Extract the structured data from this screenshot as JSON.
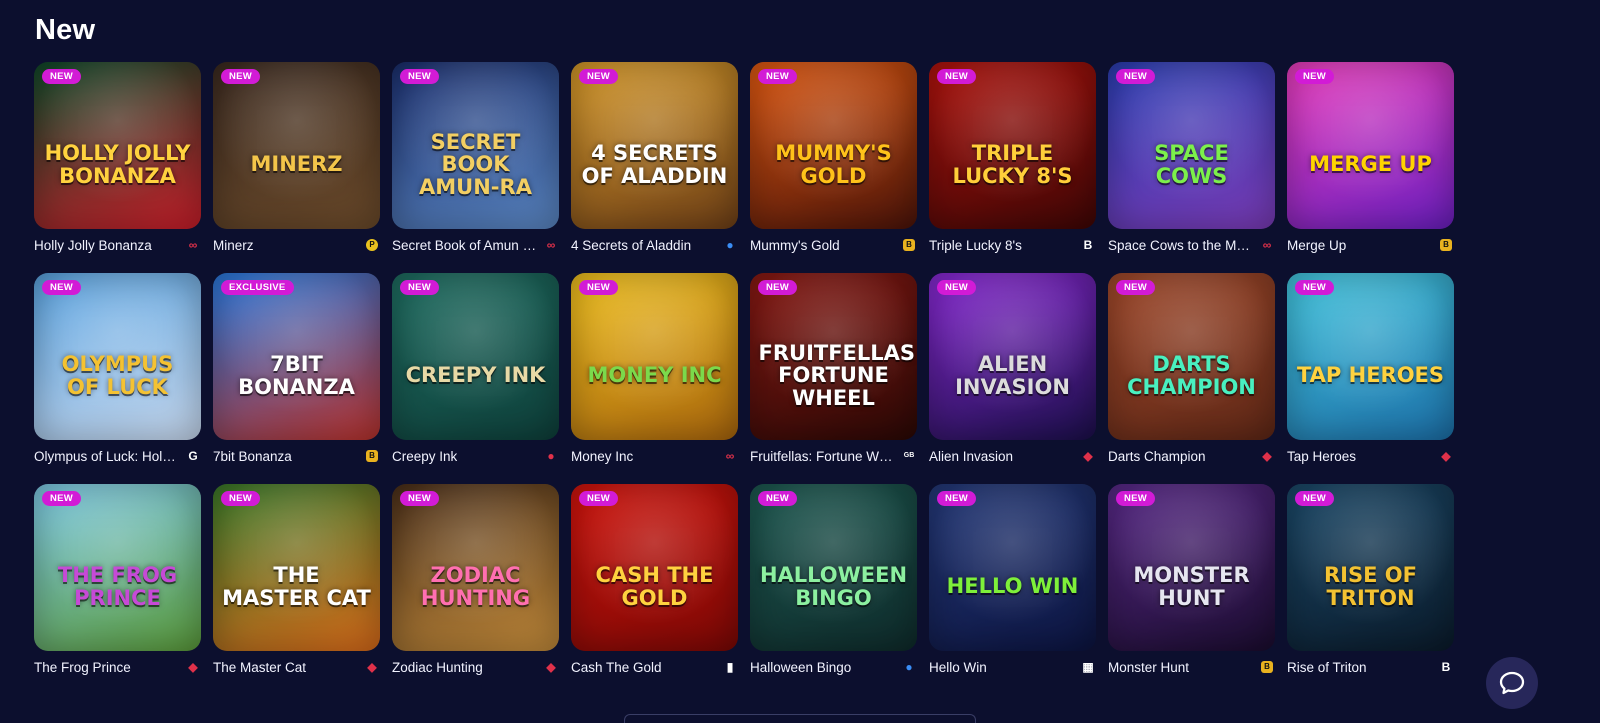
{
  "section": {
    "title": "New"
  },
  "games": [
    {
      "name": "Holly Jolly Bonanza",
      "badge": "NEW",
      "logo": "Holly Jolly Bonanza",
      "bg": [
        "#0f4a2a",
        "#c81e2a"
      ],
      "logo_color": "#ffd23f",
      "provider_icon": "infinity-icon",
      "provider_glyph": "∞",
      "provider_color": "#e0314a"
    },
    {
      "name": "Minerz",
      "badge": "NEW",
      "logo": "Minerz",
      "bg": [
        "#3b2a20",
        "#6b4a2a"
      ],
      "logo_color": "#f3c54a",
      "provider_icon": "p-provider-icon",
      "provider_glyph": "P",
      "provider_color": "#e9c21f"
    },
    {
      "name": "Secret Book of Amun Ra",
      "badge": "NEW",
      "logo": "Secret Book Amun-Ra",
      "bg": [
        "#1b2f6e",
        "#5a86c2"
      ],
      "logo_color": "#f3cf63",
      "provider_icon": "infinity-icon",
      "provider_glyph": "∞",
      "provider_color": "#e0314a"
    },
    {
      "name": "4 Secrets of Aladdin",
      "badge": "NEW",
      "logo": "4 Secrets of Aladdin",
      "bg": [
        "#d89b2b",
        "#6e3f17"
      ],
      "logo_color": "#ffffff",
      "provider_icon": "blue-gem-icon",
      "provider_glyph": "●",
      "provider_color": "#3a8df5"
    },
    {
      "name": "Mummy's Gold",
      "badge": "NEW",
      "logo": "Mummy's Gold",
      "bg": [
        "#e25a12",
        "#4a1309"
      ],
      "logo_color": "#ffc21a",
      "provider_icon": "b-provider-icon",
      "provider_glyph": "B",
      "provider_color": "#e9b21f"
    },
    {
      "name": "Triple Lucky 8's",
      "badge": "NEW",
      "logo": "Triple Lucky 8's",
      "bg": [
        "#b3140e",
        "#3d0605"
      ],
      "logo_color": "#ffcf3a",
      "provider_icon": "bb-provider-icon",
      "provider_glyph": "B",
      "provider_color": "#ffffff"
    },
    {
      "name": "Space Cows to the Moo'n",
      "badge": "NEW",
      "logo": "Space Cows",
      "bg": [
        "#2c3fb3",
        "#7a3bb6"
      ],
      "logo_color": "#7cf04b",
      "provider_icon": "infinity-icon",
      "provider_glyph": "∞",
      "provider_color": "#e0314a"
    },
    {
      "name": "Merge Up",
      "badge": "NEW",
      "logo": "Merge Up",
      "bg": [
        "#ec3fbf",
        "#6a1fbf"
      ],
      "logo_color": "#ffd400",
      "provider_icon": "b-provider-icon",
      "provider_glyph": "B",
      "provider_color": "#e9b21f"
    },
    {
      "name": "Olympus of Luck: Hold the Spin",
      "badge": "NEW",
      "logo": "Olympus of Luck",
      "bg": [
        "#5aa3e0",
        "#c7d8ee"
      ],
      "logo_color": "#f4c232",
      "provider_icon": "g-provider-icon",
      "provider_glyph": "G",
      "provider_color": "#ffffff"
    },
    {
      "name": "7bit Bonanza",
      "badge": "EXCLUSIVE",
      "logo": "7bit Bonanza",
      "bg": [
        "#2a7ae0",
        "#b8322c"
      ],
      "logo_color": "#ffffff",
      "provider_icon": "b-provider-icon",
      "provider_glyph": "B",
      "provider_color": "#e9b21f"
    },
    {
      "name": "Creepy Ink",
      "badge": "NEW",
      "logo": "Creepy Ink",
      "bg": [
        "#1f6e62",
        "#0e3f3a"
      ],
      "logo_color": "#e8d9a6",
      "provider_icon": "red-drop-icon",
      "provider_glyph": "●",
      "provider_color": "#e0314a"
    },
    {
      "name": "Money Inc",
      "badge": "NEW",
      "logo": "Money Inc",
      "bg": [
        "#f2c21f",
        "#a8650d"
      ],
      "logo_color": "#7bd94b",
      "provider_icon": "infinity-icon",
      "provider_glyph": "∞",
      "provider_color": "#e0314a"
    },
    {
      "name": "Fruitfellas: Fortune Wheel",
      "badge": "NEW",
      "logo": "Fruitfellas Fortune Wheel",
      "bg": [
        "#8c1a14",
        "#2a0805"
      ],
      "logo_color": "#ffffff",
      "provider_icon": "gb-provider-icon",
      "provider_glyph": "GB",
      "provider_color": "#ffffff"
    },
    {
      "name": "Alien Invasion",
      "badge": "NEW",
      "logo": "Alien Invasion",
      "bg": [
        "#8a2ad6",
        "#1b0f4a"
      ],
      "logo_color": "#dcdcdc",
      "provider_icon": "red-dice-icon",
      "provider_glyph": "◆",
      "provider_color": "#e0314a"
    },
    {
      "name": "Darts Champion",
      "badge": "NEW",
      "logo": "Darts Champion",
      "bg": [
        "#a24a2c",
        "#5e2716"
      ],
      "logo_color": "#49f0c0",
      "provider_icon": "red-dice-icon",
      "provider_glyph": "◆",
      "provider_color": "#e0314a"
    },
    {
      "name": "Tap Heroes",
      "badge": "NEW",
      "logo": "Tap Heroes",
      "bg": [
        "#44c7e0",
        "#1c6fa8"
      ],
      "logo_color": "#ffd23f",
      "provider_icon": "red-dice-icon",
      "provider_glyph": "◆",
      "provider_color": "#e0314a"
    },
    {
      "name": "The Frog Prince",
      "badge": "NEW",
      "logo": "The Frog Prince",
      "bg": [
        "#7fcbe8",
        "#5a9a3a"
      ],
      "logo_color": "#c64ad6",
      "provider_icon": "red-dice-icon",
      "provider_glyph": "◆",
      "provider_color": "#e0314a"
    },
    {
      "name": "The Master Cat",
      "badge": "NEW",
      "logo": "The Master Cat",
      "bg": [
        "#3a7a2a",
        "#d86a1a"
      ],
      "logo_color": "#ffffff",
      "provider_icon": "red-dice-icon",
      "provider_glyph": "◆",
      "provider_color": "#e0314a"
    },
    {
      "name": "Zodiac Hunting",
      "badge": "NEW",
      "logo": "Zodiac Hunting",
      "bg": [
        "#4a2f1a",
        "#c28a3a"
      ],
      "logo_color": "#ff6fb0",
      "provider_icon": "red-dice-icon",
      "provider_glyph": "◆",
      "provider_color": "#e0314a"
    },
    {
      "name": "Cash The Gold",
      "badge": "NEW",
      "logo": "Cash The Gold",
      "bg": [
        "#d4150d",
        "#7a0805"
      ],
      "logo_color": "#ffd23f",
      "provider_icon": "card-icon",
      "provider_glyph": "▮",
      "provider_color": "#ffffff"
    },
    {
      "name": "Halloween Bingo",
      "badge": "NEW",
      "logo": "Halloween Bingo",
      "bg": [
        "#1e5a52",
        "#0e2a2a"
      ],
      "logo_color": "#8cf0a0",
      "provider_icon": "blue-gem-icon",
      "provider_glyph": "●",
      "provider_color": "#3a8df5"
    },
    {
      "name": "Hello Win",
      "badge": "NEW",
      "logo": "Hello Win",
      "bg": [
        "#253a7a",
        "#0c1440"
      ],
      "logo_color": "#7ef03a",
      "provider_icon": "grid-provider-icon",
      "provider_glyph": "▦",
      "provider_color": "#ffffff"
    },
    {
      "name": "Monster Hunt",
      "badge": "NEW",
      "logo": "Monster Hunt",
      "bg": [
        "#5a2a8a",
        "#1a0c2e"
      ],
      "logo_color": "#e6e6f0",
      "provider_icon": "b-provider-icon",
      "provider_glyph": "B",
      "provider_color": "#e9b21f"
    },
    {
      "name": "Rise of Triton",
      "badge": "NEW",
      "logo": "Rise of Triton",
      "bg": [
        "#1c4a6a",
        "#0a1a2a"
      ],
      "logo_color": "#f3c232",
      "provider_icon": "bb-provider-icon",
      "provider_glyph": "B",
      "provider_color": "#ffffff"
    }
  ],
  "chat": {
    "icon": "chat-bubble-icon"
  }
}
